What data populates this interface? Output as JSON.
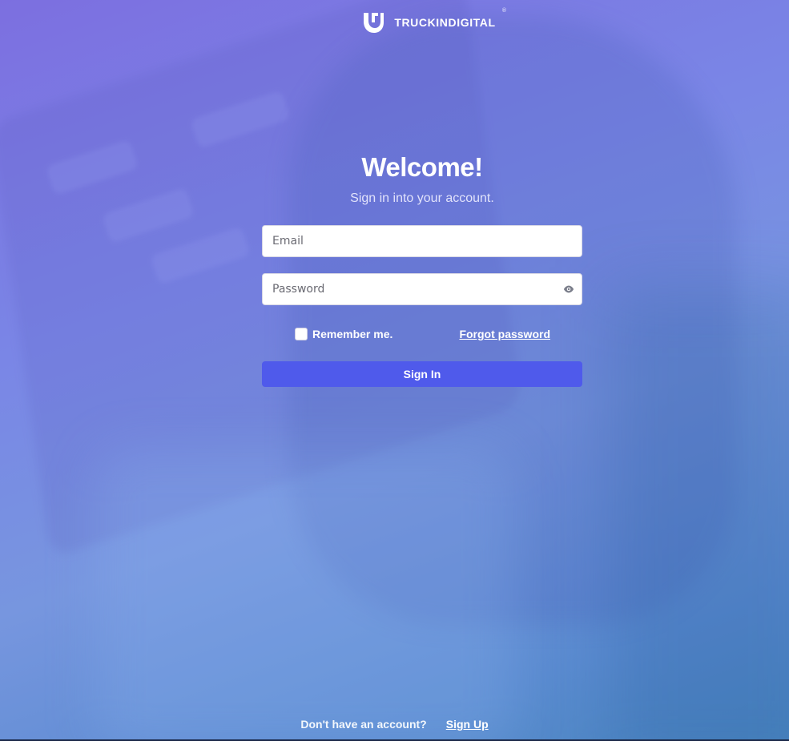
{
  "brand": {
    "name": "TRUCKINDIGITAL",
    "trademark": "®",
    "logo_icon": "truckindigital-logo-icon"
  },
  "login": {
    "title": "Welcome!",
    "subtitle": "Sign in into your account.",
    "email": {
      "value": "",
      "placeholder": "Email"
    },
    "password": {
      "value": "",
      "placeholder": "Password",
      "toggle_icon": "eye-icon"
    },
    "remember_label": "Remember me.",
    "remember_checked": false,
    "forgot_label": "Forgot password",
    "submit_label": "Sign In"
  },
  "footer": {
    "prompt": "Don't have an account?",
    "signup_label": "Sign Up"
  },
  "colors": {
    "primary_button": "#4f5aeb",
    "background_start": "#7c6fe0",
    "background_end": "#4a86c0"
  }
}
